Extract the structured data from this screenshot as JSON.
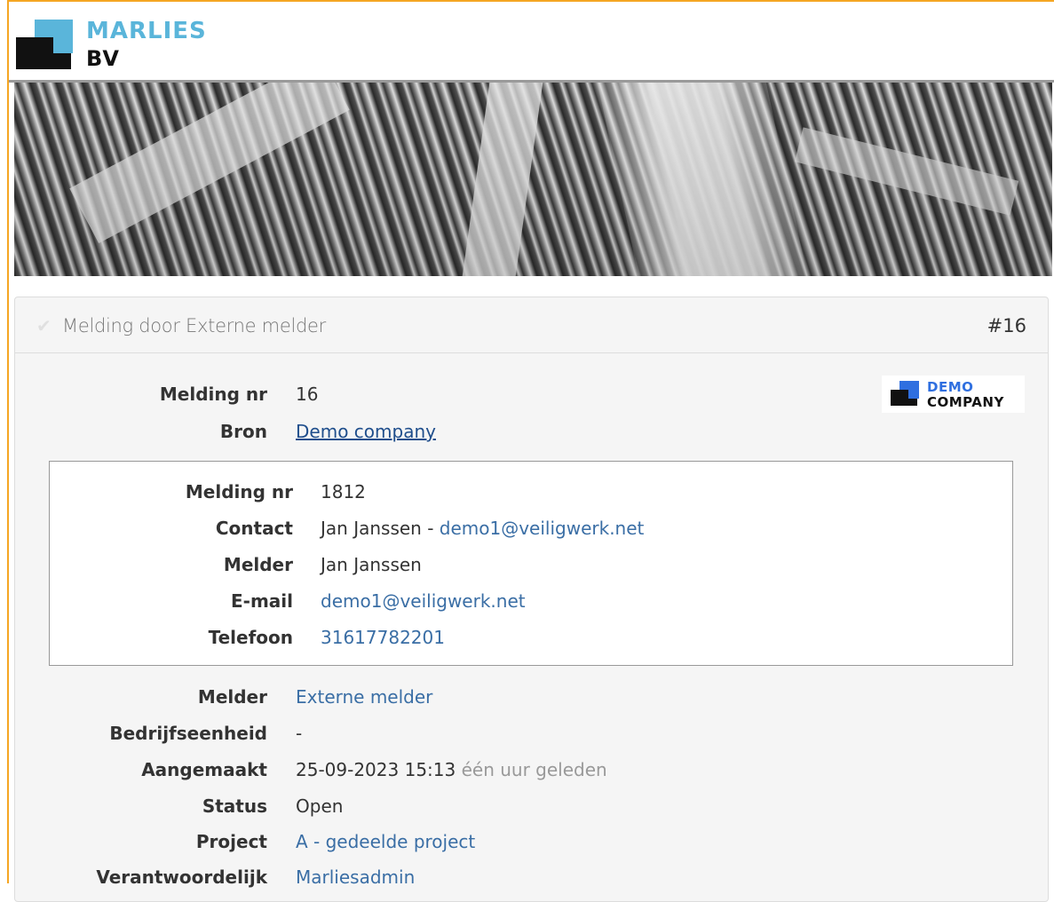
{
  "brand": {
    "line1": "MARLIES",
    "line2": "BV"
  },
  "panel": {
    "title": "Melding door Externe melder",
    "number": "#16",
    "demo_logo": {
      "line1": "DEMO",
      "line2": "COMPANY"
    },
    "fields_top": [
      {
        "label": "Melding nr",
        "value": "16"
      },
      {
        "label": "Bron",
        "value": "Demo company"
      }
    ],
    "inner": {
      "melding_nr": {
        "label": "Melding nr",
        "value": "1812"
      },
      "contact": {
        "label": "Contact",
        "name": "Jan Janssen - ",
        "email": "demo1@veiligwerk.net"
      },
      "melder": {
        "label": "Melder",
        "value": "Jan Janssen"
      },
      "email": {
        "label": "E-mail",
        "value": "demo1@veiligwerk.net"
      },
      "telefoon": {
        "label": "Telefoon",
        "value": "31617782201"
      }
    },
    "fields_bottom": {
      "melder": {
        "label": "Melder",
        "value": "Externe melder"
      },
      "bedrijfseenheid": {
        "label": "Bedrijfseenheid",
        "value": "-"
      },
      "aangemaakt": {
        "label": "Aangemaakt",
        "value": "25-09-2023 15:13",
        "relative": "één uur geleden"
      },
      "status": {
        "label": "Status",
        "value": "Open"
      },
      "project": {
        "label": "Project",
        "value": "A - gedeelde project"
      },
      "verantwoordelijk": {
        "label": "Verantwoordelijk",
        "value": "Marliesadmin"
      }
    }
  },
  "colors": {
    "accent": "#5ab5da",
    "link": "#3a6ea5",
    "frame": "#f5a623",
    "demo_blue": "#2f6fe0"
  },
  "icons": {
    "check": "check-icon"
  }
}
